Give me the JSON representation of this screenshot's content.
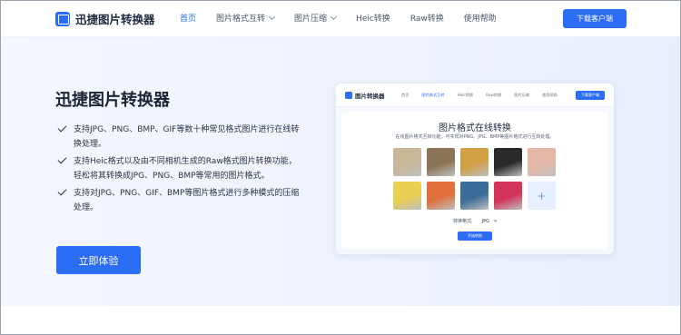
{
  "header": {
    "brand": "迅捷图片转换器",
    "nav": [
      {
        "label": "首页",
        "active": true,
        "dropdown": false
      },
      {
        "label": "图片格式互转",
        "active": false,
        "dropdown": true
      },
      {
        "label": "图片压缩",
        "active": false,
        "dropdown": true
      },
      {
        "label": "Heic转换",
        "active": false,
        "dropdown": false
      },
      {
        "label": "Raw转换",
        "active": false,
        "dropdown": false
      },
      {
        "label": "使用帮助",
        "active": false,
        "dropdown": false
      }
    ],
    "download_label": "下载客户端"
  },
  "hero": {
    "title": "迅捷图片转换器",
    "features": [
      "支持JPG、PNG、BMP、GIF等数十种常见格式图片进行在线转换处理。",
      "支持Heic格式以及由不同相机生成的Raw格式图片转换功能，轻松将其转换成JPG、PNG、BMP等常用的图片格式。",
      "支持对JPG、PNG、GIF、BMP等图片格式进行多种模式的压缩处理。"
    ],
    "cta_label": "立即体验"
  },
  "preview": {
    "brand": "图片转换器",
    "nav": [
      "首页",
      "图片格式互转",
      "Heic转换",
      "Raw转换",
      "图片压缩",
      "使用帮助"
    ],
    "active_nav": 1,
    "download_label": "下载客户端",
    "title": "图片格式在线转换",
    "subtitle": "在线图片格式互转功能，可实现对PNG、JPG、BMP等图片格式进行互转处理。",
    "format_label": "转换格式:",
    "format_value": "JPG",
    "start_label": "开始转换",
    "add_icon": "plus-icon",
    "thumbnails": [
      "#c9b79a",
      "#8a7356",
      "#d1a044",
      "#2a2a2a",
      "#e5b7a8",
      "#e9cf52",
      "#e0703c",
      "#3b6d9a",
      "#d2335a"
    ]
  },
  "colors": {
    "accent": "#2b6df5",
    "hero_bg": "#eef3fc",
    "title_text": "#1c2433"
  }
}
